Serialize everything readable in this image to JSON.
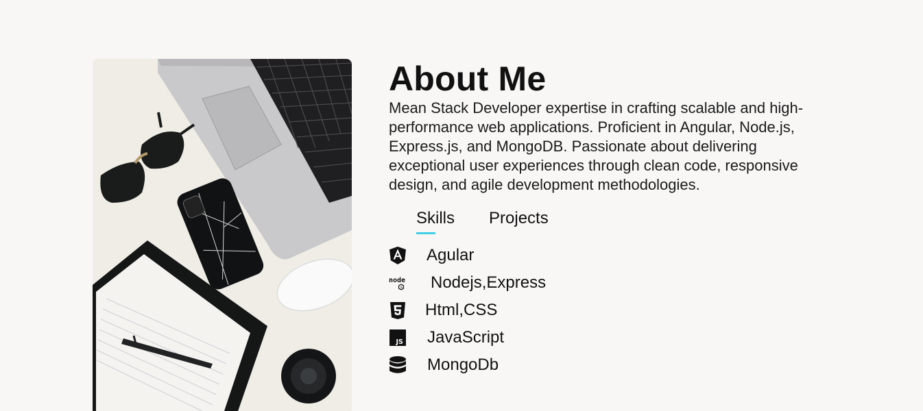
{
  "about": {
    "title": "About Me",
    "description": "Mean Stack Developer expertise in crafting scalable and high-performance web applications. Proficient in Angular, Node.js, Express.js, and MongoDB. Passionate about delivering exceptional user experiences through clean code, responsive design, and agile development methodologies."
  },
  "tabs": [
    {
      "label": "Skills",
      "active": true
    },
    {
      "label": "Projects",
      "active": false
    }
  ],
  "skills": [
    {
      "icon": "angular-icon",
      "label": "Agular"
    },
    {
      "icon": "nodejs-icon",
      "label": "Nodejs,Express"
    },
    {
      "icon": "html5-icon",
      "label": "Html,CSS"
    },
    {
      "icon": "javascript-icon",
      "label": "JavaScript"
    },
    {
      "icon": "database-icon",
      "label": "MongoDb"
    }
  ],
  "theme": {
    "background": "#f8f7f6",
    "accent": "#3ecfe6",
    "text": "#111111"
  }
}
